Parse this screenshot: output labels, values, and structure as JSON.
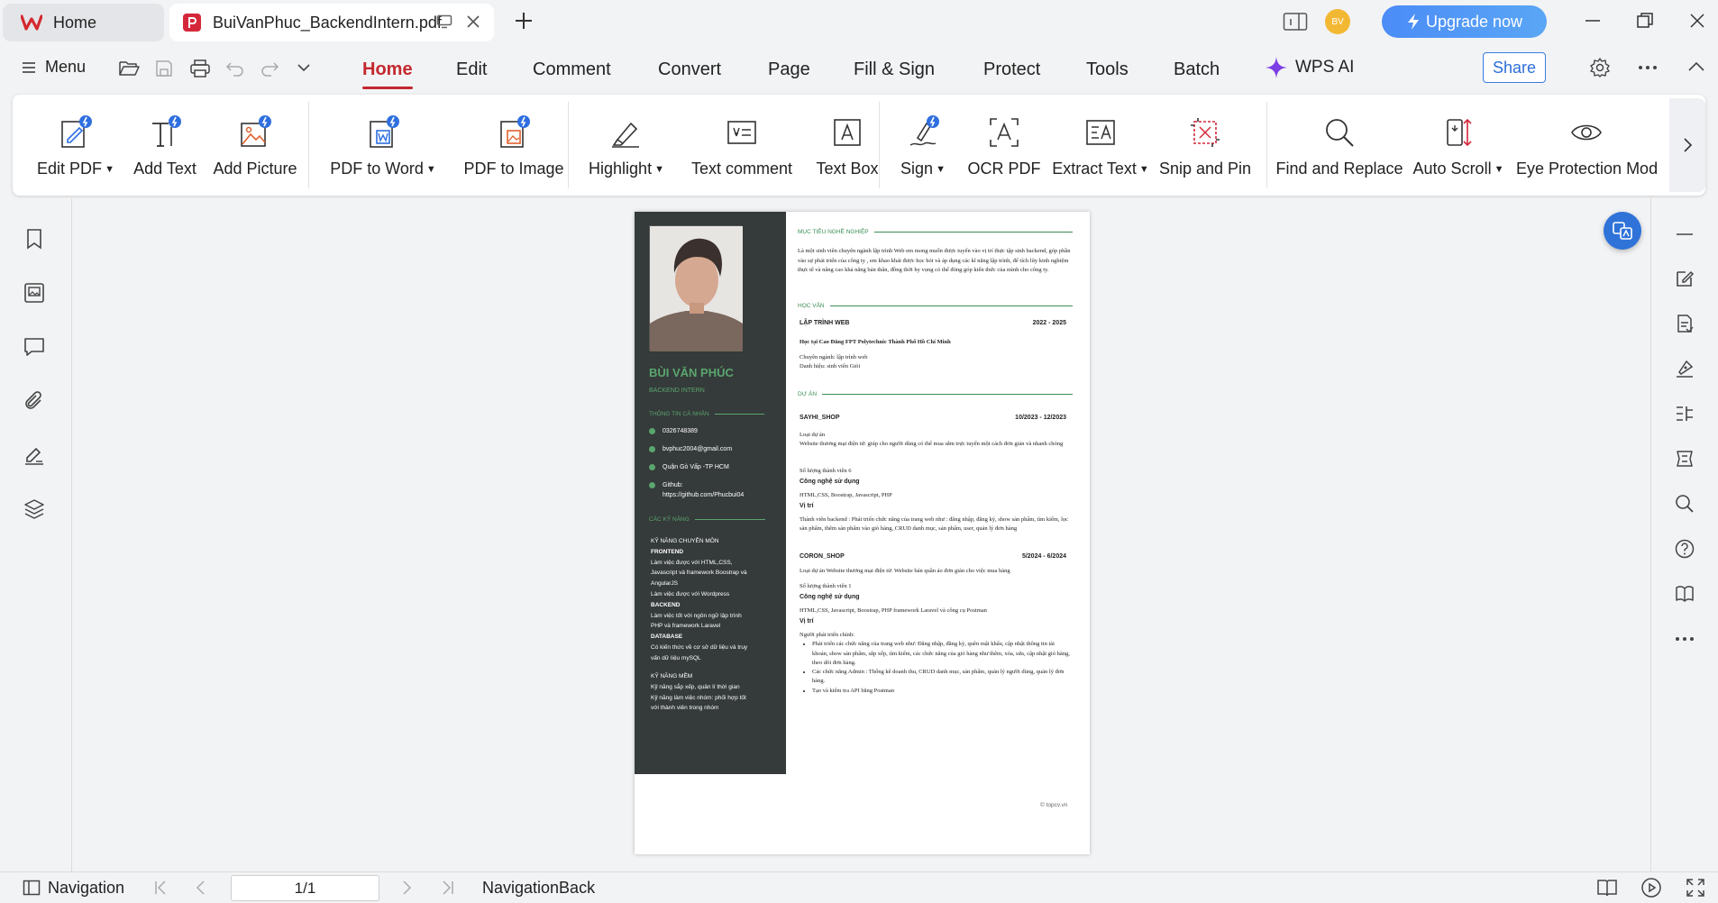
{
  "tabs": {
    "home_label": "Home",
    "doc_label": "BuiVanPhuc_BackendIntern.pdf"
  },
  "header": {
    "avatar_initials": "BV",
    "upgrade_label": "Upgrade now"
  },
  "menubar": {
    "menu_label": "Menu",
    "tabs": [
      "Home",
      "Edit",
      "Comment",
      "Convert",
      "Page",
      "Fill & Sign",
      "Protect",
      "Tools",
      "Batch"
    ],
    "active_tab": "Home",
    "wps_ai_label": "WPS AI",
    "share_label": "Share"
  },
  "ribbon": {
    "buttons": [
      {
        "label": "Edit PDF",
        "dropdown": true,
        "icon": "edit-pdf-icon"
      },
      {
        "label": "Add Text",
        "dropdown": false,
        "icon": "add-text-icon"
      },
      {
        "label": "Add Picture",
        "dropdown": false,
        "icon": "add-picture-icon"
      },
      {
        "label": "PDF to Word",
        "dropdown": true,
        "icon": "pdf-to-word-icon"
      },
      {
        "label": "PDF to Image",
        "dropdown": false,
        "icon": "pdf-to-image-icon"
      },
      {
        "label": "Highlight",
        "dropdown": true,
        "icon": "highlight-icon"
      },
      {
        "label": "Text comment",
        "dropdown": false,
        "icon": "text-comment-icon"
      },
      {
        "label": "Text Box",
        "dropdown": false,
        "icon": "text-box-icon"
      },
      {
        "label": "Sign",
        "dropdown": true,
        "icon": "sign-icon"
      },
      {
        "label": "OCR PDF",
        "dropdown": false,
        "icon": "ocr-icon"
      },
      {
        "label": "Extract Text",
        "dropdown": true,
        "icon": "extract-text-icon"
      },
      {
        "label": "Snip and Pin",
        "dropdown": false,
        "icon": "snip-pin-icon"
      },
      {
        "label": "Find and Replace",
        "dropdown": false,
        "icon": "find-replace-icon"
      },
      {
        "label": "Auto Scroll",
        "dropdown": true,
        "icon": "auto-scroll-icon"
      },
      {
        "label": "Eye Protection Mod",
        "dropdown": false,
        "icon": "eye-icon"
      }
    ]
  },
  "cv": {
    "name": "BÙI VĂN PHÚC",
    "role": "BACKEND INTERN",
    "contact_heading": "THÔNG TIN CÁ NHÂN",
    "phone": "0326748389",
    "email": "bvphuc2004@gmail.com",
    "address": "Quận Gò Vấp -TP HCM",
    "github_label": "Github:",
    "github_url": "https://github.com/Phucbui04",
    "skills_heading": "CÁC KỸ NĂNG",
    "skills_title": "KỸ NĂNG CHUYÊN MÔN",
    "skills": [
      {
        "head": "FRONTEND",
        "lines": [
          "Làm việc được với HTML,CSS,",
          "Javascript và framework Boostrap và",
          "AngularJS",
          "Làm việc được với Wordpress"
        ]
      },
      {
        "head": "BACKEND",
        "lines": [
          "Làm việc tốt với ngôn ngữ lập trình",
          "PHP và framework Laravel"
        ]
      },
      {
        "head": "DATABASE",
        "lines": [
          "Có kiến thức về cơ sở dữ liệu và truy",
          "vấn dữ liệu mySQL"
        ]
      }
    ],
    "soft_title": "KỸ NĂNG MỀM",
    "soft_lines": [
      "Kỹ năng sắp xếp, quản lí thời gian",
      "Kỹ năng làm việc nhóm: phối hợp tốt",
      "với thành viên trong nhóm"
    ],
    "objective_heading": "MỤC TIÊU NGHỀ NGHIỆP",
    "objective_text": "Là một sinh viên chuyên ngành lập trình Web em mong muốn được tuyển vào vị trí thực tập sinh backend, góp phần vào sự phát triển của công ty , em khao khát được học hỏi và áp dụng các kĩ năng lập trình, để tích lũy kinh nghiệm thực tế và nâng cao khả năng bản thân, đồng thời hy vọng có thể đóng góp kiến thức của mình cho công ty.",
    "education_heading": "HỌC VẤN",
    "edu_title": "LẬP TRÌNH WEB",
    "edu_dates": "2022 - 2025",
    "edu_school": "Học tại Cao Đẳng FPT Polytechnic Thành Phố Hồ Chí Minh",
    "edu_major": "Chuyên ngành: lập trình web",
    "edu_rank": "Danh hiệu: sinh viên Giỏi",
    "projects_heading": "DỰ ÁN",
    "p1_title": "SAYHI_SHOP",
    "p1_dates": "10/2023 - 12/2023",
    "p1_type": "Loại dự án",
    "p1_desc": "Website thương mại điện tử: giúp cho người dùng có thể mua sắm trực tuyến một cách đơn giản và nhanh chóng",
    "p1_members": "Số lượng thành viên 6",
    "tech_label": "Công nghệ sử dụng",
    "p1_tech": "HTML,CSS, Boostrap, Javascript, PHP",
    "role_label": "Vị trí",
    "p1_role": "Thành viên backend : Phát triển chức năng của trang web như : đăng nhập, đăng ký, show sản phẩm, tìm kiếm, lọc sản phẩm, thêm sản phẩm vào giỏ hàng, CRUD danh mục, sản phẩm, user, quản lý đơn hàng",
    "p2_title": "CORON_SHOP",
    "p2_dates": "5/2024 - 6/2024",
    "p2_desc": "Loại dự án Website thương mại điện tử: Website bán quần áo đơn giản cho việc mua hàng",
    "p2_members": "Số lượng thành viên 1",
    "p2_tech": "HTML,CSS, Javascript, Boostrap, PHP framework Laravel và công cụ Postman",
    "p2_role_head": "Người phát triển chính:",
    "p2_bullets": [
      "Phát triển các chức năng của trang web như: Đăng nhập, đăng ký, quên mật khẩu, cập nhật thông tin tài khoản, show sản phẩm, sắp xếp, tìm kiếm, các chức năng của giỏ hàng như thêm, xóa, sửa, cập nhật giỏ hàng, theo dõi đơn hàng.",
      "Các chức năng Admin : Thống kê doanh thu, CRUD danh mục, sản phẩm, quản lý người dùng, quản lý đơn hàng.",
      "Tạo và kiểm tra API bằng Postman"
    ],
    "footer": "© topcv.vn"
  },
  "statusbar": {
    "navigation_label": "Navigation",
    "page_value": "1/1",
    "navigation_back_label": "NavigationBack"
  },
  "colors": {
    "accent_red": "#c4282e",
    "upgrade_blue": "#4b8cf7",
    "cv_sidebar": "#353a3a",
    "cv_green": "#5aa66e"
  }
}
